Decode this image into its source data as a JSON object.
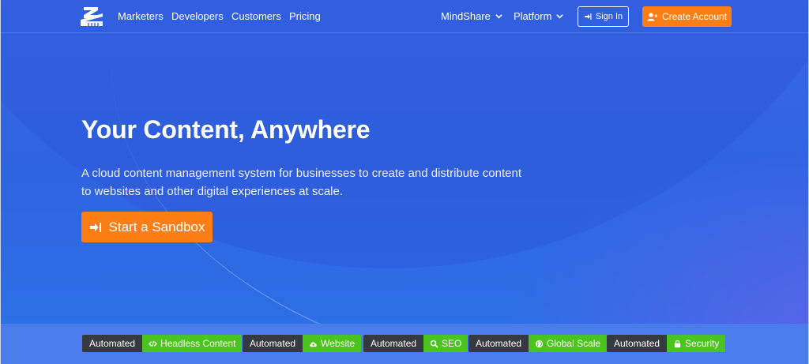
{
  "nav": {
    "links": [
      "Marketers",
      "Developers",
      "Customers",
      "Pricing"
    ],
    "mindshare": "MindShare",
    "platform": "Platform",
    "signin": "Sign In",
    "create_account": "Create Account"
  },
  "hero": {
    "title": "Your Content, Anywhere",
    "subtitle": "A cloud content management system for businesses to create and distribute content to websites and other digital experiences at scale.",
    "cta": "Start a Sandbox"
  },
  "badges": [
    {
      "left": "Automated",
      "right": "Headless Content",
      "icon": "code-icon"
    },
    {
      "left": "Automated",
      "right": "Website",
      "icon": "cloud-upload-icon"
    },
    {
      "left": "Automated",
      "right": "SEO",
      "icon": "search-icon"
    },
    {
      "left": "Automated",
      "right": "Global Scale",
      "icon": "globe-icon"
    },
    {
      "left": "Automated",
      "right": "Security",
      "icon": "lock-icon"
    }
  ],
  "colors": {
    "hero_blue": "#3a67e8",
    "accent_orange": "#fd7e14",
    "badge_dark": "#343a40",
    "badge_green": "#4cc41f"
  }
}
